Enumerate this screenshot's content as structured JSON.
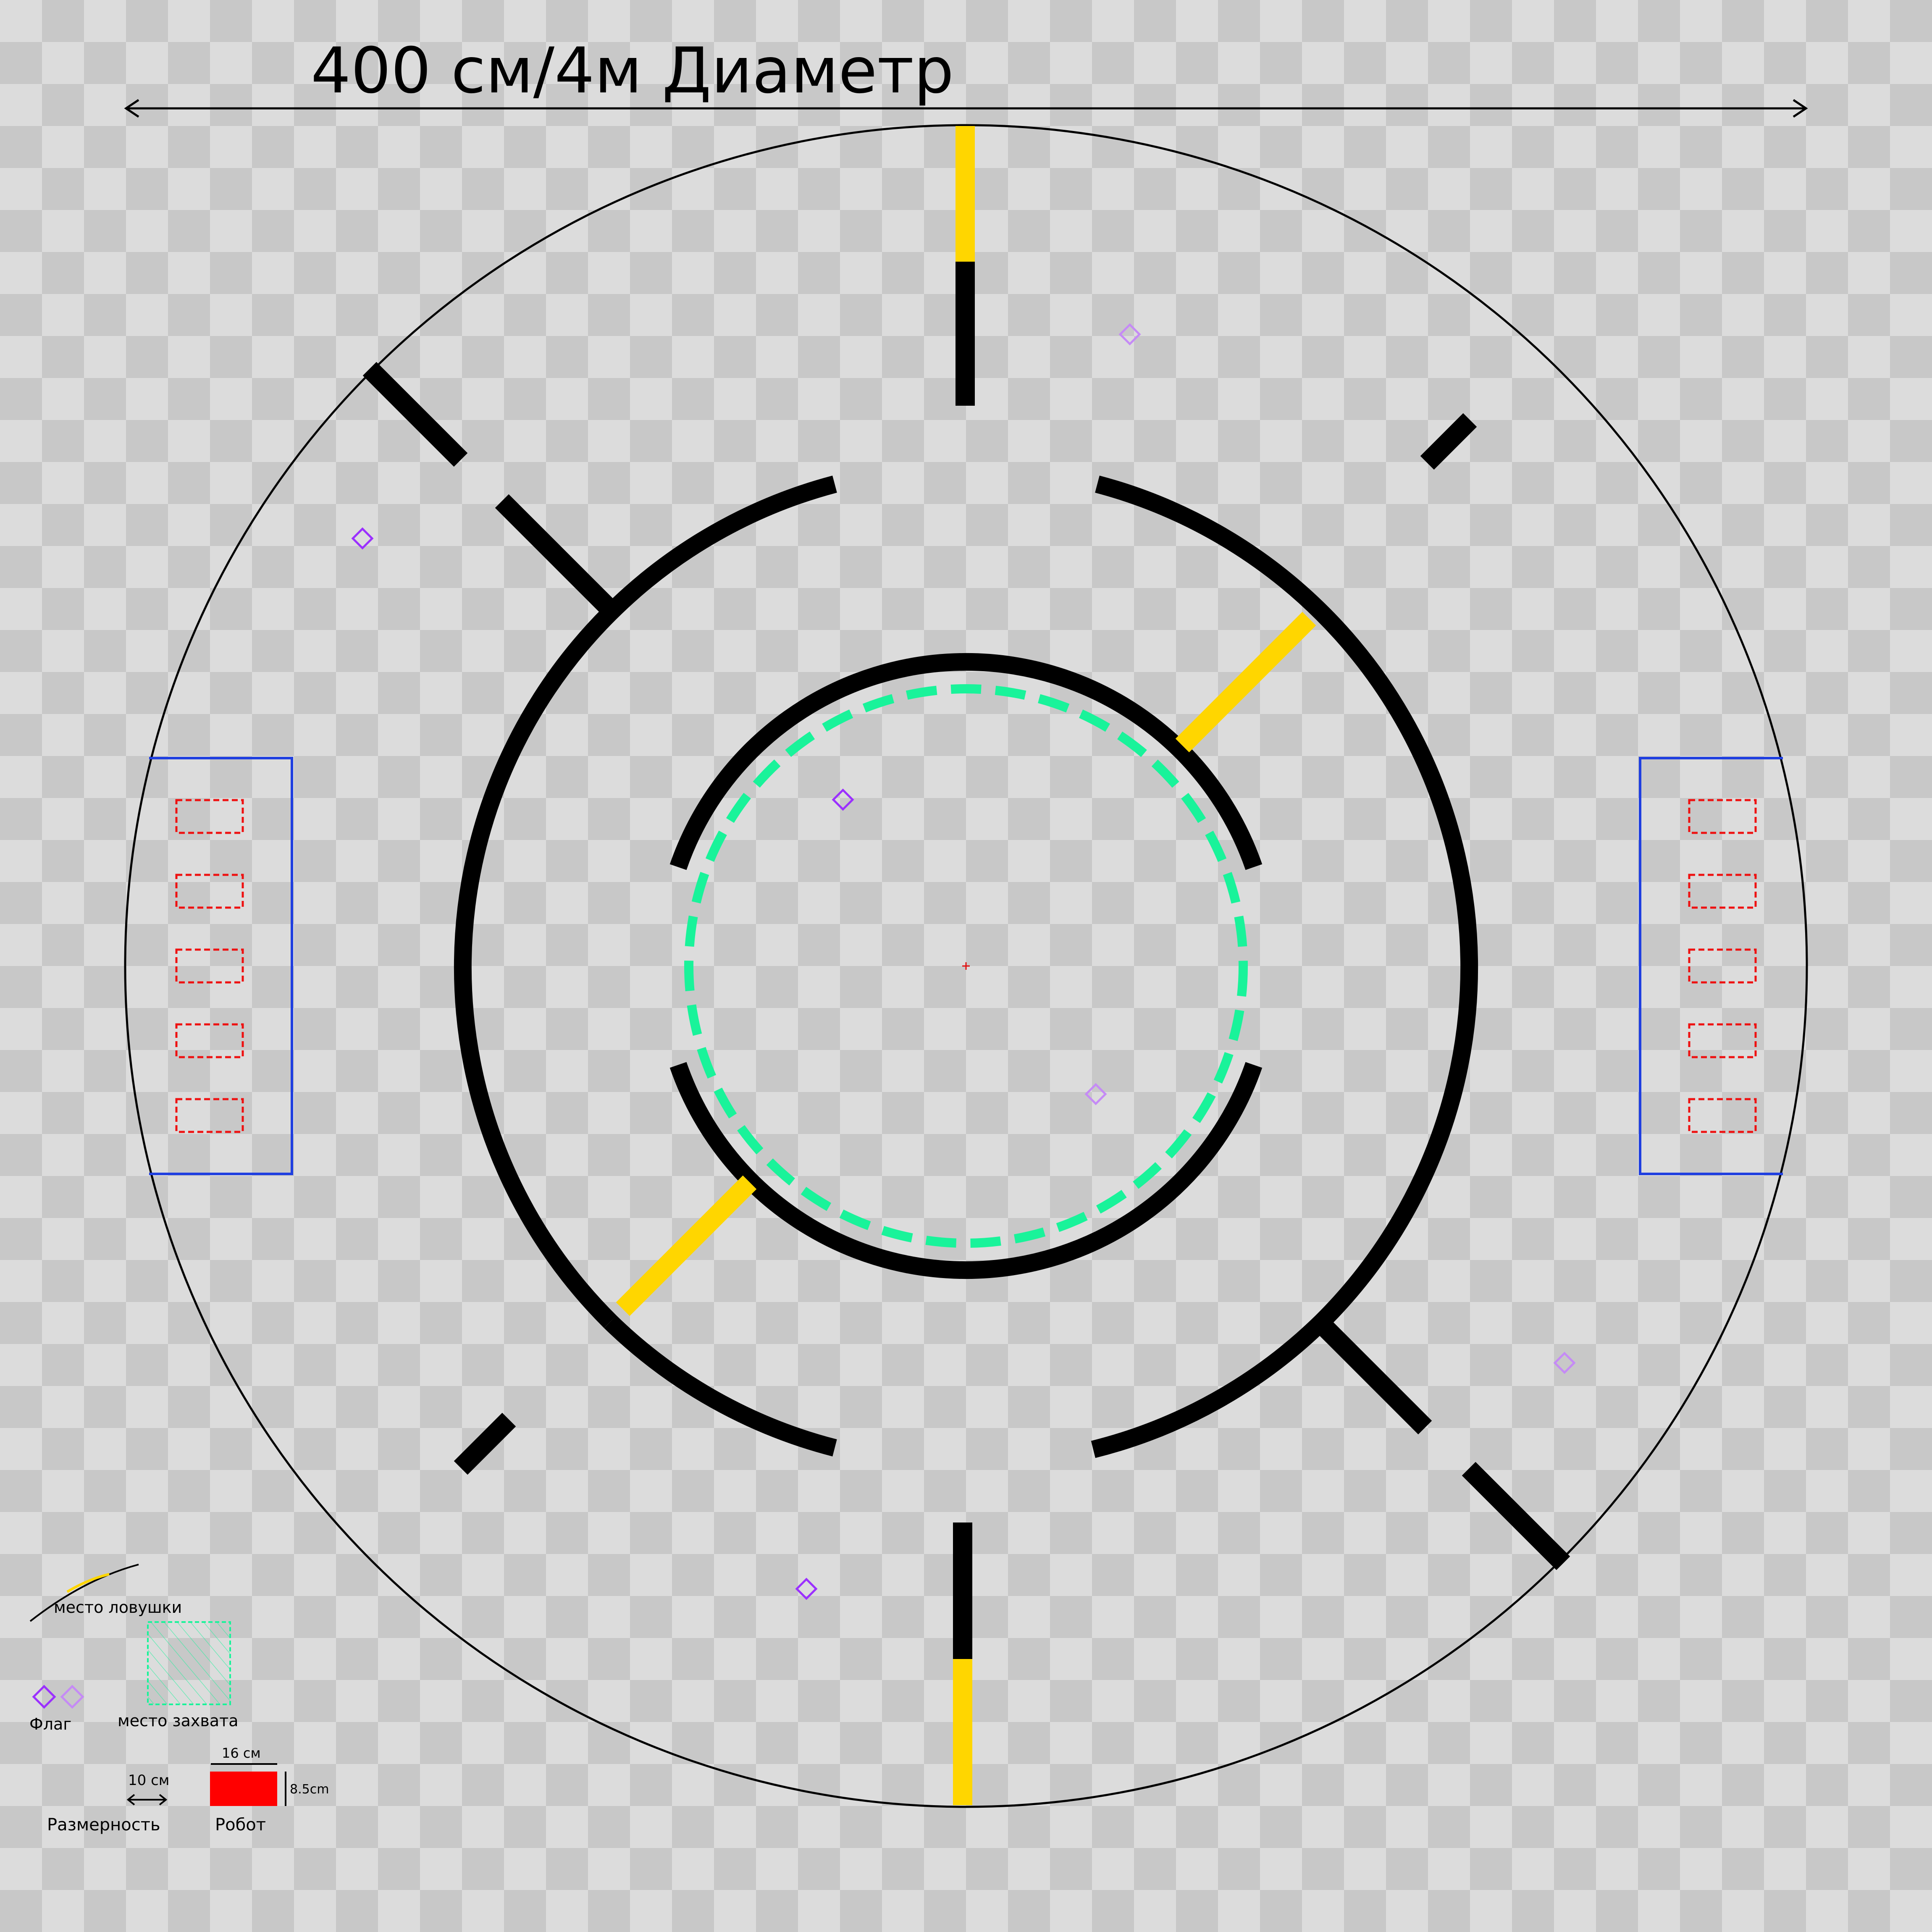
{
  "title": "400 см/4м   Диаметр",
  "legend": {
    "trap_label": "место ловушки",
    "capture_label": "место захвата",
    "flag_label": "Флаг",
    "scale_value": "10 см",
    "scale_label": "Размерность",
    "robot_width": "16 см",
    "robot_height": "8.5cm",
    "robot_label": "Робот"
  },
  "colors": {
    "wall": "#000000",
    "trap": "#ffd600",
    "capture_zone": "#19f39a",
    "base_outline": "#1f3fe0",
    "start_slot": "#ee1111",
    "flag": "#9b30ff",
    "robot": "#ff0000"
  },
  "icons": [
    "flag-diamond-icon",
    "center-cross-icon",
    "dimension-arrow-icon"
  ]
}
